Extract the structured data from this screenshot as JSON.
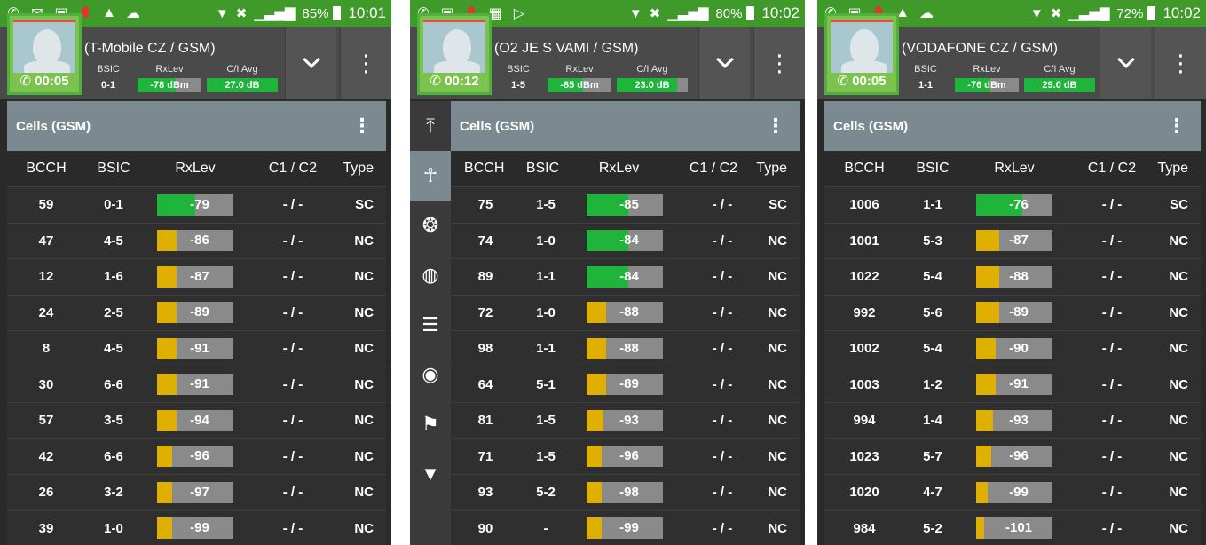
{
  "panels": [
    {
      "status": {
        "icons": [
          "phone-icon",
          "mail-icon",
          "photo-icon",
          "alert-icon",
          "warning-icon",
          "cloud-icon"
        ],
        "battery": "85%",
        "time": "10:01"
      },
      "call_timer": "00:05",
      "operator": "(T-Mobile CZ / GSM)",
      "metrics": {
        "bsic_label": "BSIC",
        "bsic": "0-1",
        "rxlev_label": "RxLev",
        "rxlev": "-78 dBm",
        "rxlev_fraction": 0.6,
        "ci_label": "C/I Avg",
        "ci": "27.0 dB",
        "ci_fraction": 1.0
      },
      "section_title": "Cells (GSM)",
      "headers": [
        "BCCH",
        "BSIC",
        "RxLev",
        "C1 / C2",
        "Type"
      ],
      "rows": [
        {
          "bcch": "59",
          "bsic": "0-1",
          "rxlev": "-79",
          "c12": "- / -",
          "type": "SC",
          "level": 0.5,
          "color": "#1eb53a"
        },
        {
          "bcch": "47",
          "bsic": "4-5",
          "rxlev": "-86",
          "c12": "- / -",
          "type": "NC",
          "level": 0.25,
          "color": "#e0b000"
        },
        {
          "bcch": "12",
          "bsic": "1-6",
          "rxlev": "-87",
          "c12": "- / -",
          "type": "NC",
          "level": 0.25,
          "color": "#e0b000"
        },
        {
          "bcch": "24",
          "bsic": "2-5",
          "rxlev": "-89",
          "c12": "- / -",
          "type": "NC",
          "level": 0.25,
          "color": "#e0b000"
        },
        {
          "bcch": "8",
          "bsic": "4-5",
          "rxlev": "-91",
          "c12": "- / -",
          "type": "NC",
          "level": 0.25,
          "color": "#e0b000"
        },
        {
          "bcch": "30",
          "bsic": "6-6",
          "rxlev": "-91",
          "c12": "- / -",
          "type": "NC",
          "level": 0.25,
          "color": "#e0b000"
        },
        {
          "bcch": "57",
          "bsic": "3-5",
          "rxlev": "-94",
          "c12": "- / -",
          "type": "NC",
          "level": 0.25,
          "color": "#e0b000"
        },
        {
          "bcch": "42",
          "bsic": "6-6",
          "rxlev": "-96",
          "c12": "- / -",
          "type": "NC",
          "level": 0.2,
          "color": "#e0b000"
        },
        {
          "bcch": "26",
          "bsic": "3-2",
          "rxlev": "-97",
          "c12": "- / -",
          "type": "NC",
          "level": 0.2,
          "color": "#e0b000"
        },
        {
          "bcch": "39",
          "bsic": "1-0",
          "rxlev": "-99",
          "c12": "- / -",
          "type": "NC",
          "level": 0.2,
          "color": "#e0b000"
        }
      ]
    },
    {
      "status": {
        "icons": [
          "phone-icon",
          "photo-icon",
          "alert-icon",
          "calendar-icon",
          "play-icon"
        ],
        "battery": "80%",
        "time": "10:02"
      },
      "call_timer": "00:12",
      "operator": "(O2 JE S VAMI / GSM)",
      "metrics": {
        "bsic_label": "BSIC",
        "bsic": "1-5",
        "rxlev_label": "RxLev",
        "rxlev": "-85 dBm",
        "rxlev_fraction": 0.55,
        "ci_label": "C/I Avg",
        "ci": "23.0 dB",
        "ci_fraction": 0.85
      },
      "section_title": "Cells (GSM)",
      "headers": [
        "BCCH",
        "BSIC",
        "RxLev",
        "C1 / C2",
        "Type"
      ],
      "rows": [
        {
          "bcch": "75",
          "bsic": "1-5",
          "rxlev": "-85",
          "c12": "- / -",
          "type": "SC",
          "level": 0.55,
          "color": "#1eb53a"
        },
        {
          "bcch": "74",
          "bsic": "1-0",
          "rxlev": "-84",
          "c12": "- / -",
          "type": "NC",
          "level": 0.55,
          "color": "#1eb53a"
        },
        {
          "bcch": "89",
          "bsic": "1-1",
          "rxlev": "-84",
          "c12": "- / -",
          "type": "NC",
          "level": 0.55,
          "color": "#1eb53a"
        },
        {
          "bcch": "72",
          "bsic": "1-0",
          "rxlev": "-88",
          "c12": "- / -",
          "type": "NC",
          "level": 0.25,
          "color": "#e0b000"
        },
        {
          "bcch": "98",
          "bsic": "1-1",
          "rxlev": "-88",
          "c12": "- / -",
          "type": "NC",
          "level": 0.25,
          "color": "#e0b000"
        },
        {
          "bcch": "64",
          "bsic": "5-1",
          "rxlev": "-89",
          "c12": "- / -",
          "type": "NC",
          "level": 0.25,
          "color": "#e0b000"
        },
        {
          "bcch": "81",
          "bsic": "1-5",
          "rxlev": "-93",
          "c12": "- / -",
          "type": "NC",
          "level": 0.22,
          "color": "#e0b000"
        },
        {
          "bcch": "71",
          "bsic": "1-5",
          "rxlev": "-96",
          "c12": "- / -",
          "type": "NC",
          "level": 0.2,
          "color": "#e0b000"
        },
        {
          "bcch": "93",
          "bsic": "5-2",
          "rxlev": "-98",
          "c12": "- / -",
          "type": "NC",
          "level": 0.2,
          "color": "#e0b000"
        },
        {
          "bcch": "90",
          "bsic": "-",
          "rxlev": "-99",
          "c12": "- / -",
          "type": "NC",
          "level": 0.2,
          "color": "#e0b000"
        }
      ],
      "rail": [
        "upload-icon",
        "antenna-icon",
        "network-icon",
        "globe-icon",
        "list-icon",
        "alert-circle-icon",
        "flag-icon",
        "location-icon"
      ]
    },
    {
      "status": {
        "icons": [
          "phone-icon",
          "photo-icon",
          "alert-icon",
          "warning-icon",
          "cloud-icon"
        ],
        "battery": "72%",
        "time": "10:02"
      },
      "call_timer": "00:05",
      "operator": "(VODAFONE CZ / GSM)",
      "metrics": {
        "bsic_label": "BSIC",
        "bsic": "1-1",
        "rxlev_label": "RxLev",
        "rxlev": "-76 dBm",
        "rxlev_fraction": 0.55,
        "ci_label": "C/I Avg",
        "ci": "29.0 dB",
        "ci_fraction": 1.0
      },
      "section_title": "Cells (GSM)",
      "headers": [
        "BCCH",
        "BSIC",
        "RxLev",
        "C1 / C2",
        "Type"
      ],
      "rows": [
        {
          "bcch": "1006",
          "bsic": "1-1",
          "rxlev": "-76",
          "c12": "- / -",
          "type": "SC",
          "level": 0.6,
          "color": "#1eb53a"
        },
        {
          "bcch": "1001",
          "bsic": "5-3",
          "rxlev": "-87",
          "c12": "- / -",
          "type": "NC",
          "level": 0.3,
          "color": "#e0b000"
        },
        {
          "bcch": "1022",
          "bsic": "5-4",
          "rxlev": "-88",
          "c12": "- / -",
          "type": "NC",
          "level": 0.3,
          "color": "#e0b000"
        },
        {
          "bcch": "992",
          "bsic": "5-6",
          "rxlev": "-89",
          "c12": "- / -",
          "type": "NC",
          "level": 0.3,
          "color": "#e0b000"
        },
        {
          "bcch": "1002",
          "bsic": "5-4",
          "rxlev": "-90",
          "c12": "- / -",
          "type": "NC",
          "level": 0.25,
          "color": "#e0b000"
        },
        {
          "bcch": "1003",
          "bsic": "1-2",
          "rxlev": "-91",
          "c12": "- / -",
          "type": "NC",
          "level": 0.25,
          "color": "#e0b000"
        },
        {
          "bcch": "994",
          "bsic": "1-4",
          "rxlev": "-93",
          "c12": "- / -",
          "type": "NC",
          "level": 0.22,
          "color": "#e0b000"
        },
        {
          "bcch": "1023",
          "bsic": "5-7",
          "rxlev": "-96",
          "c12": "- / -",
          "type": "NC",
          "level": 0.2,
          "color": "#e0b000"
        },
        {
          "bcch": "1020",
          "bsic": "4-7",
          "rxlev": "-99",
          "c12": "- / -",
          "type": "NC",
          "level": 0.15,
          "color": "#e0b000"
        },
        {
          "bcch": "984",
          "bsic": "5-2",
          "rxlev": "-101",
          "c12": "- / -",
          "type": "NC",
          "level": 0.1,
          "color": "#e0b000"
        }
      ]
    }
  ]
}
